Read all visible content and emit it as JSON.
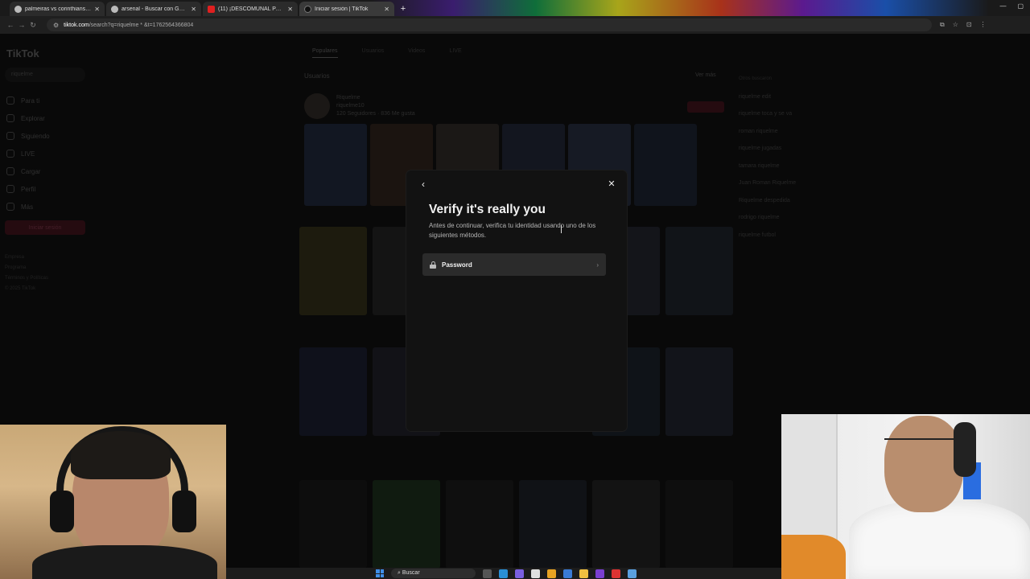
{
  "browser": {
    "tabs": [
      {
        "title": "palmeiras vs corinthians - Busc",
        "icon": "google-icon",
        "active": false
      },
      {
        "title": "arsenal - Buscar con Google",
        "icon": "google-icon",
        "active": false
      },
      {
        "title": "(11) ¡DESCOMUNAL PARTIDO D",
        "icon": "youtube-icon",
        "active": false
      },
      {
        "title": "Iniciar sesión | TikTok",
        "icon": "tiktok-icon",
        "active": true
      }
    ],
    "new_tab": "+",
    "url_host": "tiktok.com",
    "url_path": "/search?q=riquelme * &t=1762564366804"
  },
  "tiktok": {
    "logo": "TikTok",
    "search_value": "riquelme",
    "nav": [
      "Para ti",
      "Explorar",
      "Siguiendo",
      "LIVE",
      "Cargar",
      "Perfil",
      "Más"
    ],
    "login_button": "Iniciar sesión",
    "footer": [
      "Empresa",
      "Programa",
      "Términos y Políticas",
      "© 2025 TikTok"
    ],
    "tabs": [
      "Populares",
      "Usuarios",
      "Videos",
      "LIVE"
    ],
    "users_heading": "Usuarios",
    "see_more": "Ver más",
    "user": {
      "name": "Riquelme",
      "handle": "riquelme10",
      "stats": "120 Seguidores · 836 Me gusta"
    },
    "follow_button": "Seguir",
    "related_heading": "Otros buscaron",
    "related": [
      "riquelme edit",
      "riquelme toca y se va",
      "roman riquelme",
      "riquelme jugadas",
      "tamara riquelme",
      "Juan Roman Riquelme",
      "Riquelme despedida",
      "rodrigo riquelme",
      "riquelme futbol"
    ]
  },
  "modal": {
    "title": "Verify it's really you",
    "description": "Antes de continuar, verifica tu identidad usando uno de los siguientes métodos.",
    "method_label": "Password",
    "method_icon": "lock-icon"
  },
  "taskbar": {
    "search_label": "Buscar"
  },
  "colors": {
    "modal_bg": "#121212",
    "option_bg": "#2b2b2b",
    "brand_red": "#fe2c55"
  }
}
